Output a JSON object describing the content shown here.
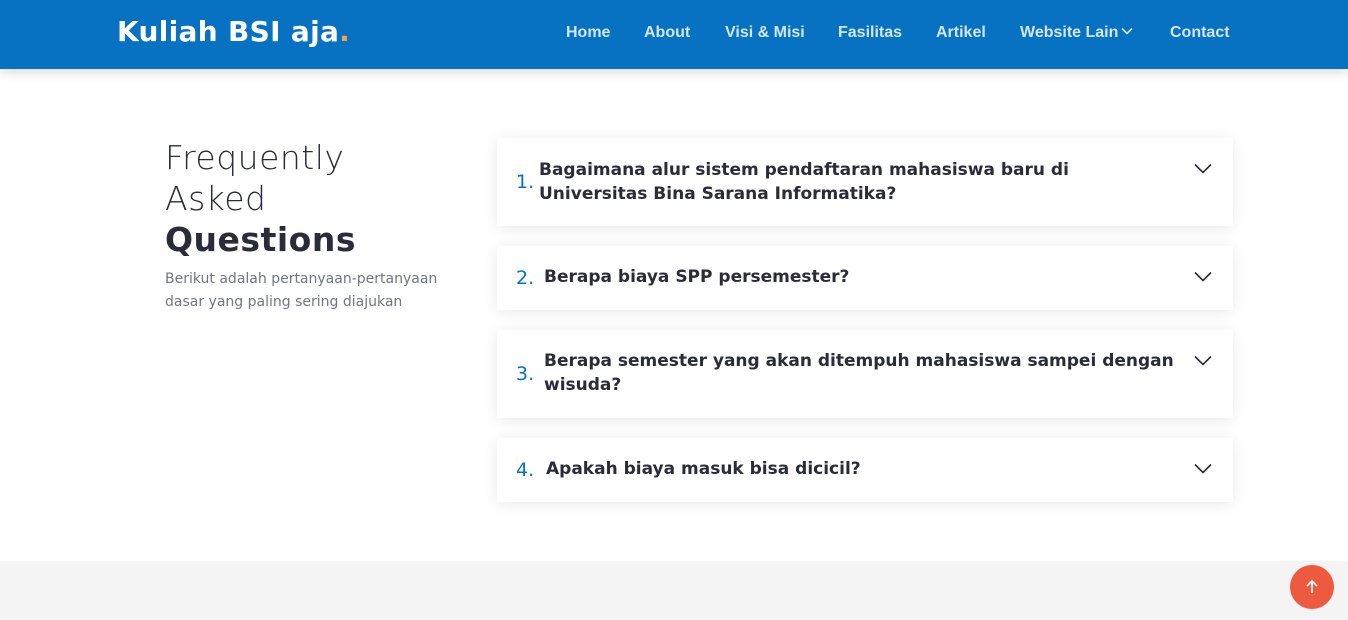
{
  "header": {
    "logo_text": "Kuliah BSI aja",
    "logo_dot": ".",
    "nav": [
      {
        "label": "Home"
      },
      {
        "label": "About"
      },
      {
        "label": "Visi & Misi"
      },
      {
        "label": "Fasilitas"
      },
      {
        "label": "Artikel"
      },
      {
        "label": "Website Lain",
        "icon": "chevron-down-icon"
      },
      {
        "label": "Contact"
      }
    ]
  },
  "faq": {
    "title_line1": "Frequently",
    "title_line2": "Asked",
    "title_line3": "Questions",
    "subtitle": "Berikut adalah pertanyaan-pertanyaan dasar yang paling sering diajukan",
    "items": [
      {
        "number": "1.",
        "question": "Bagaimana alur sistem pendaftaran mahasiswa baru di Universitas Bina Sarana Informatika?"
      },
      {
        "number": "2.",
        "question": "Berapa biaya SPP persemester?"
      },
      {
        "number": "3.",
        "question": "Berapa semester yang akan ditempuh mahasiswa sampei dengan wisuda?"
      },
      {
        "number": "4.",
        "question": "Apakah biaya masuk bisa dicicil?"
      }
    ]
  },
  "colors": {
    "header_bg": "#0672c1",
    "accent": "#f8a24b",
    "back_to_top": "#ee5a3f"
  },
  "icons": {
    "faq_toggle": "chevron-down-icon",
    "back_to_top": "arrow-up-icon"
  }
}
